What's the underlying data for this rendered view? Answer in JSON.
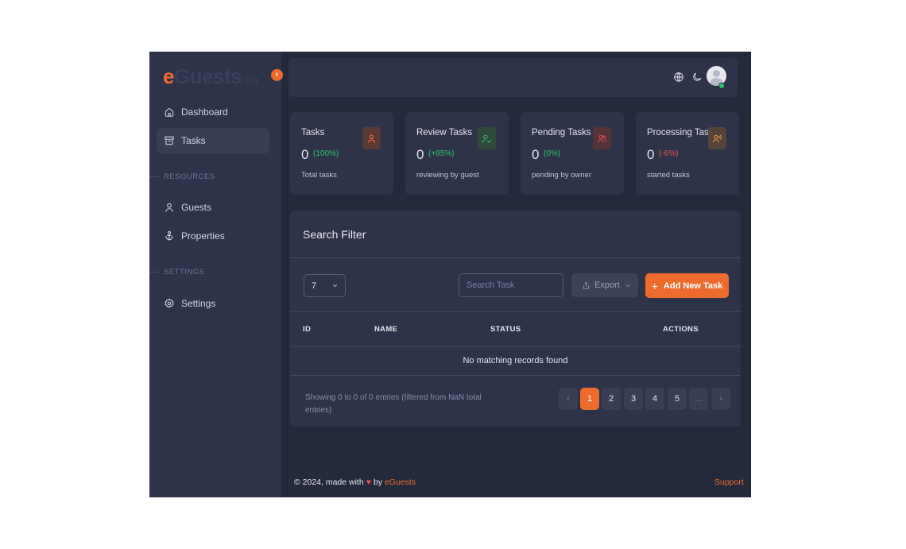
{
  "brand": {
    "logo_e": "e",
    "logo_rest": "Guests",
    "logo_tld": ".eu"
  },
  "colors": {
    "accent": "#ec6b2d",
    "background": "#25293c",
    "surface": "#2f3349",
    "success": "#28c76f",
    "danger": "#ea5455",
    "warning": "#ff9f43"
  },
  "sidebar": {
    "collapse_icon": "chevron-left-icon",
    "items": [
      {
        "label": "Dashboard",
        "icon": "home-icon"
      },
      {
        "label": "Tasks",
        "icon": "archive-icon",
        "active": true
      }
    ],
    "sections": [
      {
        "title": "RESOURCES",
        "items": [
          {
            "label": "Guests",
            "icon": "user-icon"
          },
          {
            "label": "Properties",
            "icon": "anchor-icon"
          }
        ]
      },
      {
        "title": "SETTINGS",
        "items": [
          {
            "label": "Settings",
            "icon": "gear-icon"
          }
        ]
      }
    ]
  },
  "topbar": {
    "icons": [
      "globe-icon",
      "moon-icon"
    ],
    "avatar_status": "online"
  },
  "stats": [
    {
      "title": "Tasks",
      "value": "0",
      "pct": "(100%)",
      "sub": "Total tasks",
      "icon": "user-icon",
      "pct_color": "#28c76f",
      "badge_color": "#ff7a45"
    },
    {
      "title": "Review Tasks",
      "value": "0",
      "pct": "(+95%)",
      "sub": "reviewing by guest",
      "icon": "user-check-icon",
      "pct_color": "#28c76f",
      "badge_color": "#28c76f"
    },
    {
      "title": "Pending Tasks",
      "value": "0",
      "pct": "(0%)",
      "sub": "pending by owner",
      "icon": "users-icon",
      "pct_color": "#28c76f",
      "badge_color": "#ea5455"
    },
    {
      "title": "Processing Tasks",
      "value": "0",
      "pct": "(-6%)",
      "sub": "started tasks",
      "icon": "user-voice-icon",
      "pct_color": "#ea5455",
      "badge_color": "#ff9f43"
    }
  ],
  "panel": {
    "title": "Search Filter",
    "page_length": "7",
    "search_placeholder": "Search Task",
    "export_label": "Export",
    "add_label": "Add New Task",
    "columns": [
      "ID",
      "NAME",
      "STATUS",
      "ACTIONS"
    ],
    "empty_message": "No matching records found",
    "info": "Showing 0 to 0 of 0 entries (filtered from NaN total entries)",
    "pagination": {
      "prev": "‹",
      "pages": [
        "1",
        "2",
        "3",
        "4",
        "5"
      ],
      "ellipsis": "...",
      "next": "›",
      "current": "1"
    }
  },
  "footer": {
    "copyright": "© 2024, made with",
    "by": "by",
    "brand": "eGuests",
    "support": "Support"
  }
}
